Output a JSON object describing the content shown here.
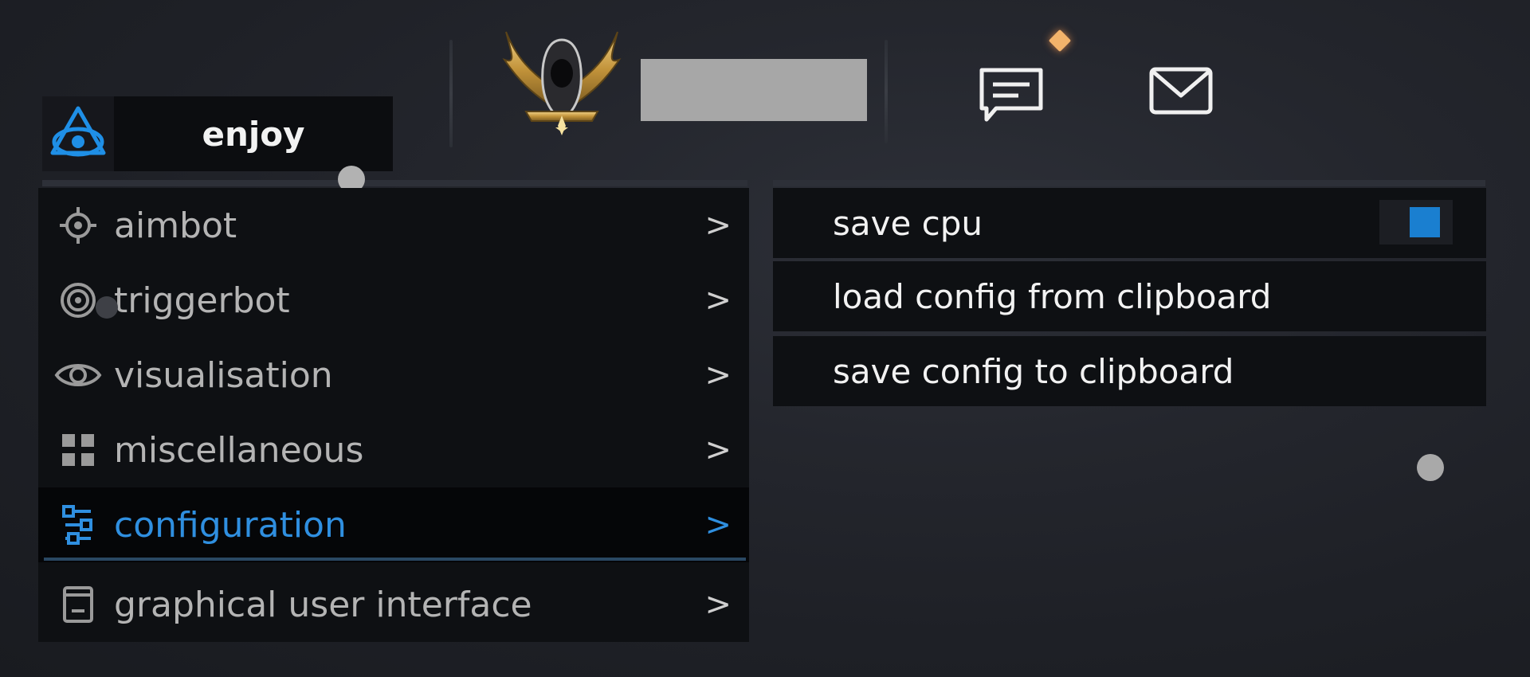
{
  "brand": {
    "name": "enjoy"
  },
  "header": {
    "emblem_icon": "winged-hooded-emblem-icon",
    "chat_icon": "chat-icon",
    "mail_icon": "mail-icon",
    "notification_color": "#f2b36b"
  },
  "menu": {
    "items": [
      {
        "label": "aimbot",
        "icon": "crosshair-icon",
        "chevron": ">",
        "active": false
      },
      {
        "label": "triggerbot",
        "icon": "target-icon",
        "chevron": ">",
        "active": false
      },
      {
        "label": "visualisation",
        "icon": "eye-icon",
        "chevron": ">",
        "active": false
      },
      {
        "label": "miscellaneous",
        "icon": "grid-icon",
        "chevron": ">",
        "active": false
      },
      {
        "label": "configuration",
        "icon": "sliders-icon",
        "chevron": ">",
        "active": true
      },
      {
        "label": "graphical user interface",
        "icon": "window-icon",
        "chevron": ">",
        "active": false
      }
    ]
  },
  "config_panel": {
    "items": [
      {
        "label": "save cpu",
        "type": "toggle",
        "checked": true
      },
      {
        "label": "load config from clipboard",
        "type": "button"
      },
      {
        "label": "save config to clipboard",
        "type": "button"
      }
    ]
  },
  "colors": {
    "accent": "#2f8fe0",
    "toggle_on": "#1a7fd0"
  }
}
